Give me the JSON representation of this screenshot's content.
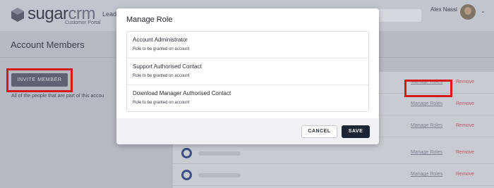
{
  "header": {
    "logo": {
      "sugar": "sugar",
      "crm": "crm",
      "subtitle": "Customer Portal"
    },
    "nav_partial": "Lead",
    "user_name": "Alex Nassi",
    "user_menu_caret": "⌄"
  },
  "page": {
    "title": "Account Members",
    "invite_button": "INVITE MEMBER",
    "description": "All of the people that are part of this accou"
  },
  "members": {
    "rows": [
      {
        "manage": "Manage Roles",
        "remove": "Remove"
      },
      {
        "manage": "Manage Roles",
        "remove": "Remove"
      },
      {
        "manage": "Manage Roles",
        "remove": "Remove"
      },
      {
        "manage": "Manage Roles",
        "remove": "Remove"
      },
      {
        "manage": "Manage Roles",
        "remove": "Remove"
      }
    ]
  },
  "modal": {
    "title": "Manage Role",
    "roles": [
      {
        "name": "Account Administrator",
        "desc": "Role to be granted on account"
      },
      {
        "name": "Support Authorised Contact",
        "desc": "Role to be granted on account"
      },
      {
        "name": "Download Manager Authorised Contact",
        "desc": "Role to be granted on account"
      }
    ],
    "cancel": "CANCEL",
    "save": "SAVE"
  },
  "colors": {
    "overlay_bg": "#b6b8c2",
    "highlight": "#d41a1a",
    "primary_button": "#1d2433",
    "remove_link": "#c25560"
  }
}
